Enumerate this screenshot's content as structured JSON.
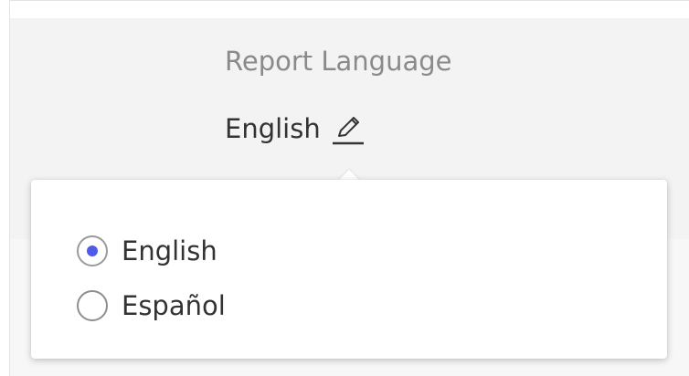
{
  "setting": {
    "label": "Report Language",
    "value": "English"
  },
  "icons": {
    "edit": "pencil-icon"
  },
  "menu": {
    "options": [
      {
        "label": "English",
        "checked": true
      },
      {
        "label": "Español",
        "checked": false
      }
    ]
  },
  "colors": {
    "radio_selected": "#4f5be8",
    "panel_bg": "#f3f3f3",
    "label_text": "#8a8a8a",
    "value_text": "#333333"
  }
}
